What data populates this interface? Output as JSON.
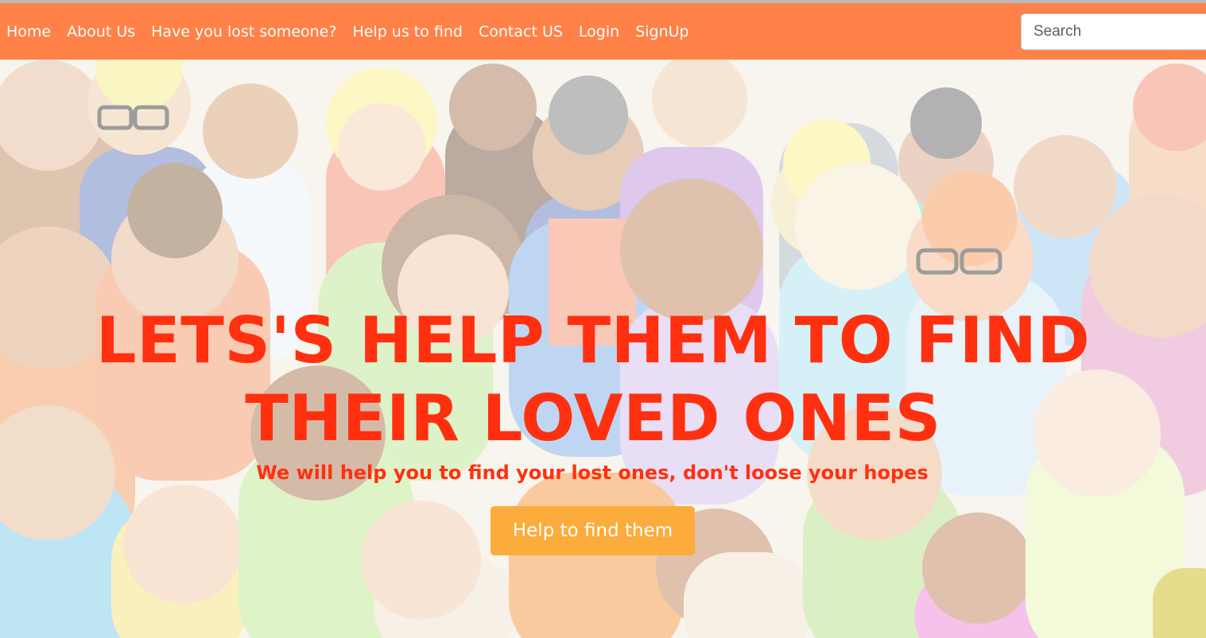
{
  "nav": {
    "items": [
      {
        "label": "Home"
      },
      {
        "label": "About Us"
      },
      {
        "label": "Have you lost someone?"
      },
      {
        "label": "Help us to find"
      },
      {
        "label": "Contact US"
      },
      {
        "label": "Login"
      },
      {
        "label": "SignUp"
      }
    ],
    "search_placeholder": "Search"
  },
  "hero": {
    "headline": "LETS'S HELP THEM TO FIND THEIR LOVED ONES",
    "subheadline": "We will help you to find your lost ones, don't loose your hopes",
    "button_label": "Help to find them",
    "background_image": "crowd-of-people-illustration"
  },
  "colors": {
    "navbar": "#ff8147",
    "headline": "#ff3010",
    "button": "#fbac3c"
  }
}
